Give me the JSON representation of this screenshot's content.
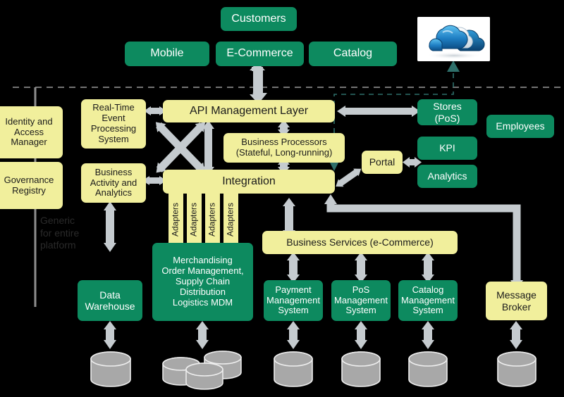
{
  "diagram": {
    "title": "Retail Digital Platform Architecture",
    "colors": {
      "background": "#000000",
      "green": "#0d8a5f",
      "yellow": "#f1ef9c",
      "arrow_gray": "#c5cbcf",
      "dashed_teal": "#2e6f6a",
      "dashed_gray": "#9a9a9a",
      "cylinder_gray": "#a8a8a8",
      "note_text": "#2a2a2a"
    },
    "channels": {
      "customers": "Customers",
      "mobile": "Mobile",
      "ecommerce": "E-Commerce",
      "catalog": "Catalog",
      "cloud_icon": "cloud-icon"
    },
    "governance": {
      "identity": "Identity and\nAccess\nManager",
      "registry": "Governance\nRegistry",
      "note": "Generic\nfor entire\nplatform"
    },
    "platform": {
      "rteps": "Real-Time\nEvent\nProcessing\nSystem",
      "baa": "Business\nActivity and\nAnalytics",
      "api_layer": "API Management Layer",
      "business_processors": "Business Processors\n(Stateful, Long-running)",
      "integration": "Integration",
      "portal": "Portal",
      "business_services": "Business Services (e-Commerce)",
      "message_broker": "Message\nBroker",
      "adapters": [
        "Adapters",
        "Adapters",
        "Adapters",
        "Adapters"
      ]
    },
    "consumers": {
      "stores": "Stores\n(PoS)",
      "kpi": "KPI",
      "analytics": "Analytics",
      "employees": "Employees"
    },
    "backends": {
      "data_warehouse": "Data\nWarehouse",
      "mdm": "Merchandising\nOrder Management,\nSupply Chain\nDistribution\nLogistics MDM",
      "payment": "Payment\nManagement\nSystem",
      "pos": "PoS\nManagement\nSystem",
      "catalog_mgmt": "Catalog\nManagement\nSystem"
    },
    "datastores": [
      {
        "name": "data-warehouse-db",
        "kind": "single"
      },
      {
        "name": "mdm-db-cluster",
        "kind": "cluster"
      },
      {
        "name": "payment-db",
        "kind": "single"
      },
      {
        "name": "pos-db",
        "kind": "single"
      },
      {
        "name": "catalog-db",
        "kind": "single"
      },
      {
        "name": "message-broker-db",
        "kind": "single"
      }
    ]
  }
}
